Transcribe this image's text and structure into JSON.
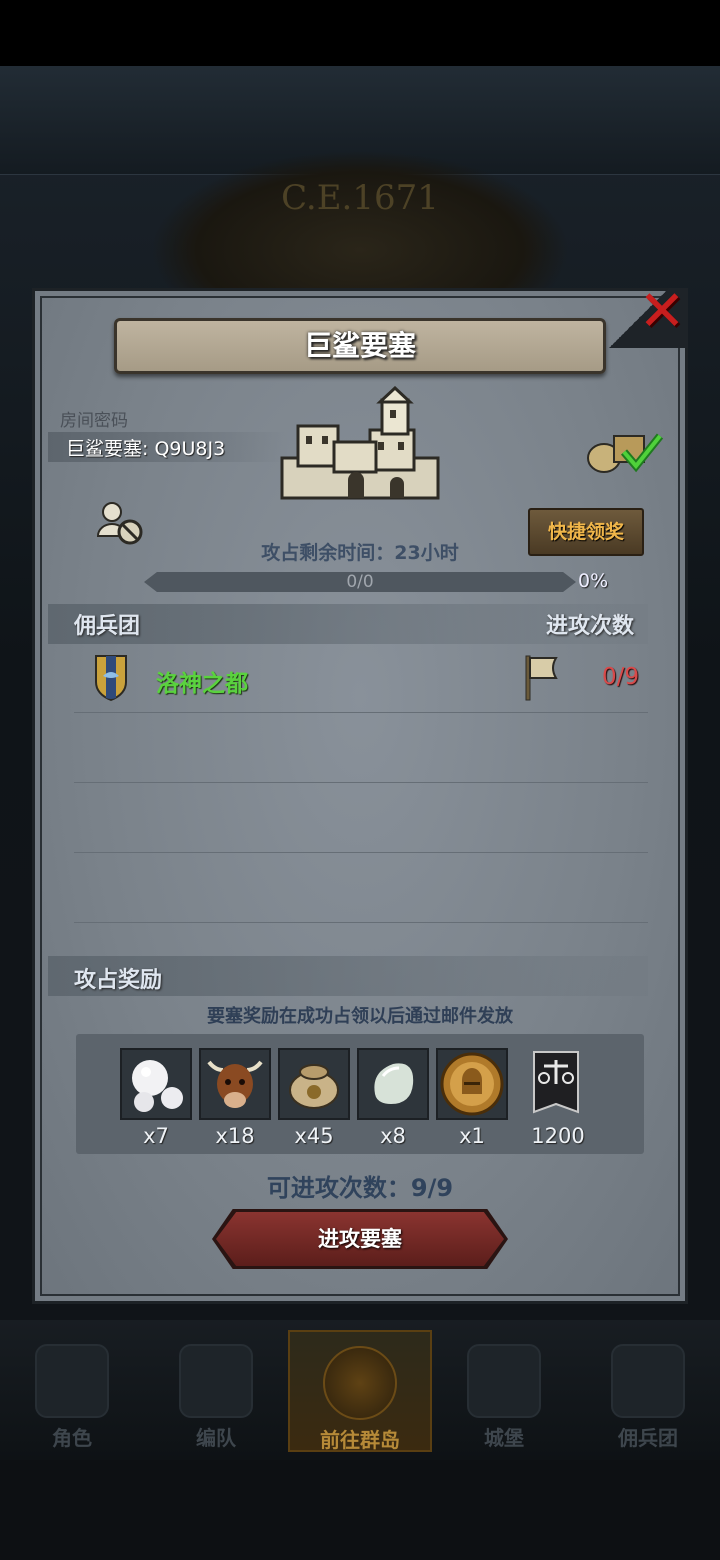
{
  "background": {
    "year": "C.E.1671"
  },
  "nav": {
    "items": [
      {
        "label": "角色",
        "icon": "knight-icon"
      },
      {
        "label": "编队",
        "icon": "helmet-icon"
      },
      {
        "label": "前往群岛",
        "icon": "island-compass-icon",
        "active": true
      },
      {
        "label": "城堡",
        "icon": "castle-icon"
      },
      {
        "label": "佣兵团",
        "icon": "warship-icon"
      }
    ]
  },
  "dialog": {
    "title": "巨鲨要塞",
    "room_label": "房间密码",
    "room_code": "巨鲨要塞: Q9U8J3",
    "quick_claim": "快捷领奖",
    "time_remaining": "攻占剩余时间：23小时",
    "progress": {
      "count": "0/0",
      "percent": "0%",
      "fraction": 0
    },
    "mercenary_header": "佣兵团",
    "attack_header": "进攻次数",
    "rows": [
      {
        "guild": "洛神之都",
        "attacks": "0/9"
      }
    ],
    "reward_header": "攻占奖励",
    "reward_note": "要塞奖励在成功占领以后通过邮件发放",
    "rewards": [
      {
        "icon": "pearl-icon",
        "qty": "x7"
      },
      {
        "icon": "cow-icon",
        "qty": "x18"
      },
      {
        "icon": "coin-bag-icon",
        "qty": "x45"
      },
      {
        "icon": "gem-stone-icon",
        "qty": "x8"
      },
      {
        "icon": "knight-medal-icon",
        "qty": "x1"
      },
      {
        "icon": "guild-banner-icon",
        "qty": "1200"
      }
    ],
    "attempts": "可进攻次数：9/9",
    "attack_button": "进攻要塞"
  },
  "colors": {
    "guild_name": "#5ad23e",
    "attack_count": "#d84a4a",
    "close": "#c81e1e",
    "quick_claim_text": "#f0b64a"
  }
}
